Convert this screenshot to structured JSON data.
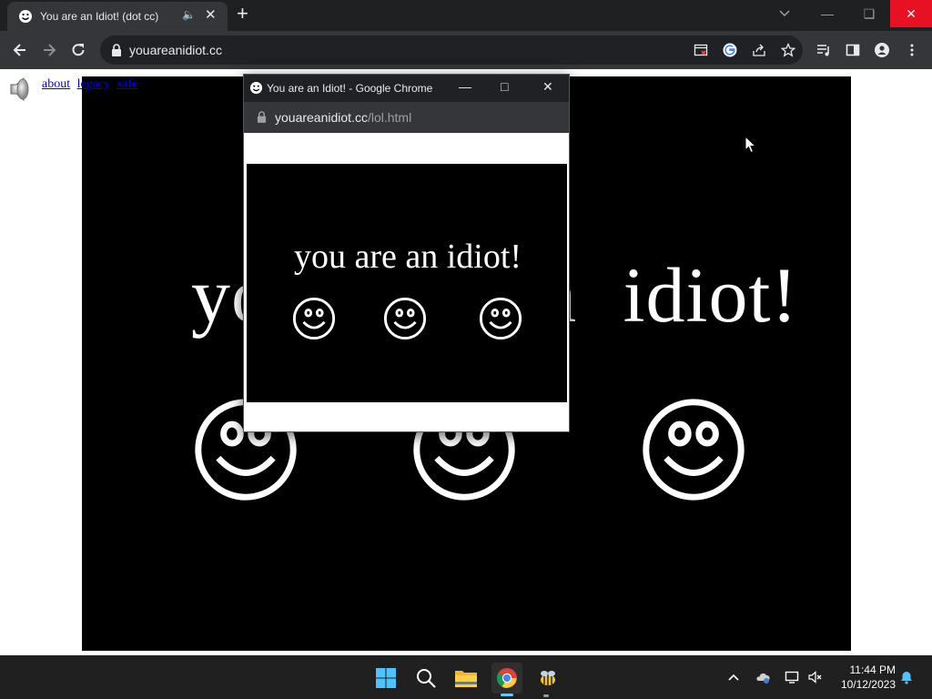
{
  "browser": {
    "tab_title": "You are an Idiot! (dot cc)",
    "url": "youareanidiot.cc"
  },
  "page": {
    "links": [
      "about",
      "legacy",
      "safe"
    ],
    "big_text": "you are an idiot!"
  },
  "popup": {
    "title": "You are an Idiot! - Google Chrome",
    "url_host": "youareanidiot.cc",
    "url_path": "/lol.html",
    "text": "you are an idiot!"
  },
  "taskbar": {
    "time": "11:44 PM",
    "date": "10/12/2023"
  },
  "icons": [
    "smiley-icon",
    "speaker-icon",
    "lock-icon",
    "star-icon",
    "profile-icon",
    "windows-start-icon",
    "search-icon",
    "file-explorer-icon",
    "chrome-icon",
    "bell-icon"
  ],
  "colors": {
    "chrome_dark": "#202124",
    "chrome_toolbar": "#35363a",
    "close_red": "#e81123",
    "link": "#0000ee"
  }
}
